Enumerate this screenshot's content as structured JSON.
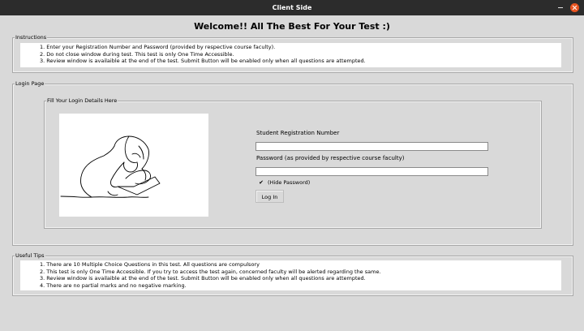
{
  "window": {
    "title": "Client Side"
  },
  "header": {
    "welcome": "Welcome!! All The Best For Your Test :)"
  },
  "instructions": {
    "legend": "Instructions",
    "lines": [
      "1. Enter your Registration Number and Password (provided by respective course faculty).",
      "2. Do not close window during test. This test is only One Time Accessible.",
      "3. Review window is availaible at the end of the test. Submit Button will be enabled only when all questions are attempted."
    ]
  },
  "login_page": {
    "legend": "Login Page",
    "details_legend": "Fill Your Login Details Here",
    "registration_label": "Student Registration Number",
    "registration_value": "",
    "password_label": "Password (as provided by respective course faculty)",
    "password_value": "",
    "hide_password_label": "(Hide Password)",
    "hide_password_checked": true,
    "login_button": "Log In"
  },
  "tips": {
    "legend": "Useful Tips",
    "lines": [
      "1. There are 10 Multiple Choice Questions in this test. All questions are compulsory",
      "2. This test is only One Time Accessible. If you try to access the test again, concerned faculty will be alerted regarding the same.",
      "3. Review window is availaible at the end of the test. Submit Button will be enabled only when all questions are attempted.",
      "4. There are no partial marks and no negative marking."
    ]
  }
}
